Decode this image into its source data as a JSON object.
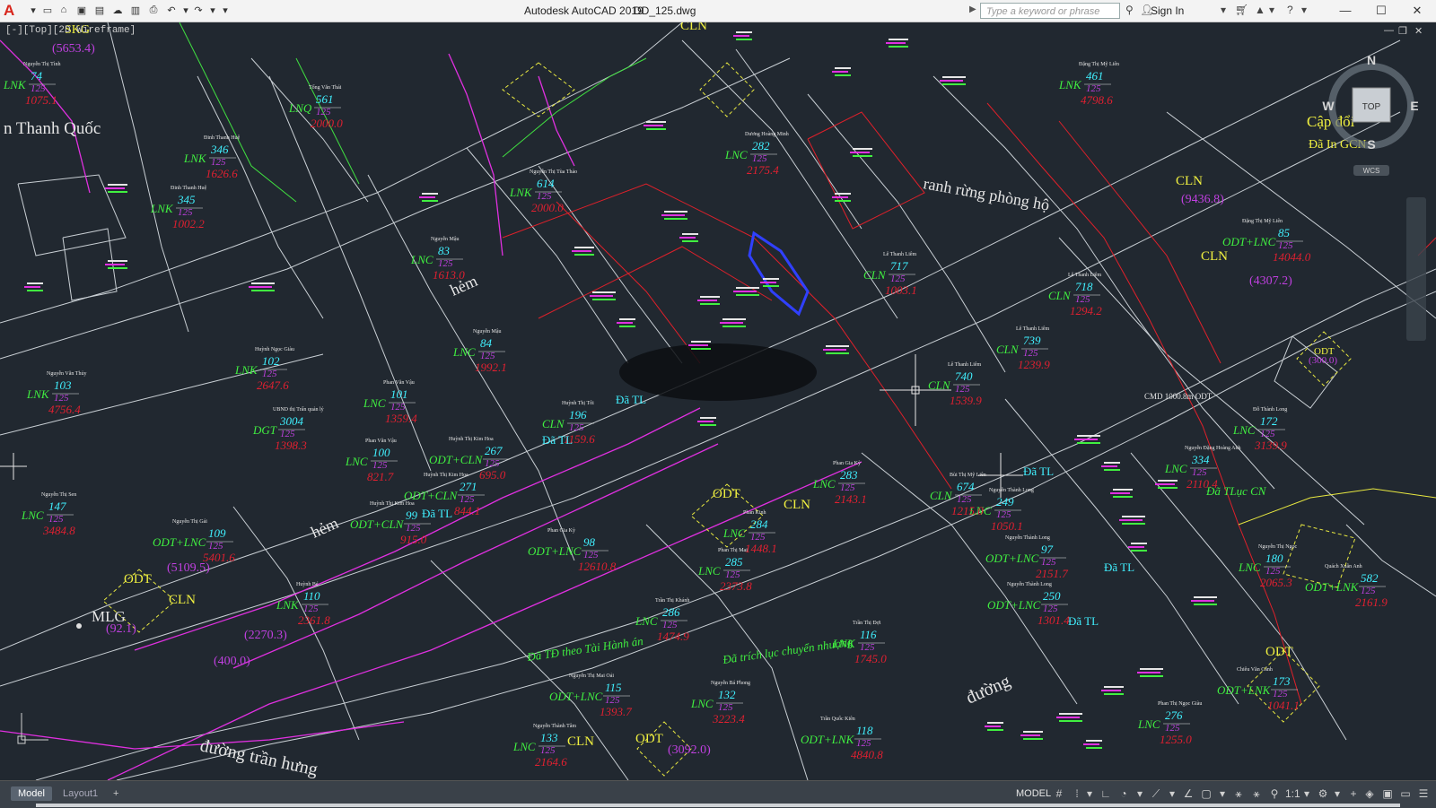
{
  "titlebar": {
    "app_title": "Autodesk AutoCAD 2019",
    "doc_title": "DD_125.dwg",
    "search_placeholder": "Type a keyword or phrase",
    "signin": "Sign In"
  },
  "viewport": {
    "label": "[-][Top][2D Wireframe]",
    "viewcube": {
      "top": "TOP",
      "n": "N",
      "s": "S",
      "e": "E",
      "w": "W",
      "wcs": "WCS"
    }
  },
  "drawing": {
    "big_labels": {
      "road_tran_hung": "đường trần hưng",
      "road_duong": "đường",
      "hem_1": "hẻm",
      "hem_2": "hẻm",
      "ranh_rung": "ranh rừng phòng hộ",
      "name_thanh_quoc": "n Thanh Quốc",
      "cap_doi": "Cập đổi",
      "da_in_gcn": "Đã In GCN",
      "mlg": "MLG",
      "sskg": "SKG"
    },
    "areas": [
      {
        "id": "a1",
        "text": "(5653.4)"
      },
      {
        "id": "a2",
        "text": "(9436.8)"
      },
      {
        "id": "a3",
        "text": "(4307.2)"
      },
      {
        "id": "a4",
        "text": "(5109.5)"
      },
      {
        "id": "a5",
        "text": "(2270.3)"
      },
      {
        "id": "a6",
        "text": "(3092.0)"
      },
      {
        "id": "a7",
        "text": "(92.1)"
      },
      {
        "id": "a8",
        "text": "(300.0)"
      },
      {
        "id": "a9",
        "text": "(400.0)"
      }
    ],
    "zones": [
      {
        "id": "z1",
        "text": "ODT"
      },
      {
        "id": "z2",
        "text": "ODT"
      },
      {
        "id": "z3",
        "text": "ODT"
      },
      {
        "id": "z4",
        "text": "ODT"
      },
      {
        "id": "z5",
        "text": "ODT"
      },
      {
        "id": "z6",
        "text": "CLN"
      },
      {
        "id": "z7",
        "text": "CLN"
      },
      {
        "id": "z8",
        "text": "CLN"
      },
      {
        "id": "z9",
        "text": "CLN"
      },
      {
        "id": "z10",
        "text": "CLN"
      },
      {
        "id": "z11",
        "text": "CLN"
      }
    ],
    "green_notes": [
      {
        "id": "g1",
        "text": "Đã TĐ theo Tài Hành án"
      },
      {
        "id": "g2",
        "text": "Đã trích lục chuyển nhượng"
      },
      {
        "id": "g3",
        "text": "Đã TLục CN"
      }
    ],
    "cyan_notes": [
      {
        "id": "c1",
        "text": "Đã TL"
      },
      {
        "id": "c2",
        "text": "Đã TL"
      },
      {
        "id": "c3",
        "text": "Đã TL"
      },
      {
        "id": "c4",
        "text": "Đã TL"
      },
      {
        "id": "c5",
        "text": "Đã TL"
      },
      {
        "id": "c6",
        "text": "Đã TL"
      }
    ],
    "cmd_label": "CMD\n1000.8m  ODT",
    "parcels": [
      {
        "id": "p1",
        "type": "LNK",
        "num": "74",
        "map": "125",
        "area": "1075.1",
        "owner": "Nguyễn Thị Tình"
      },
      {
        "id": "p2",
        "type": "LNQ",
        "num": "561",
        "map": "125",
        "area": "2000.0",
        "owner": "Tống Văn Thái"
      },
      {
        "id": "p3",
        "type": "LNK",
        "num": "346",
        "map": "125",
        "area": "1626.6",
        "owner": "Đinh Thanh Huệ"
      },
      {
        "id": "p4",
        "type": "LNK",
        "num": "345",
        "map": "125",
        "area": "1002.2",
        "owner": "Đinh Thanh Huệ"
      },
      {
        "id": "p5",
        "type": "LNK",
        "num": "614",
        "map": "125",
        "area": "2000.0",
        "owner": "Nguyễn Thị Tùa Thảo"
      },
      {
        "id": "p6",
        "type": "LNC",
        "num": "282",
        "map": "125",
        "area": "2175.4",
        "owner": "Dương Hoàng Minh"
      },
      {
        "id": "p7",
        "type": "LNK",
        "num": "461",
        "map": "125",
        "area": "4798.6",
        "owner": "Đặng Thị Mỹ Liên"
      },
      {
        "id": "p8",
        "type": "LNK",
        "num": "103",
        "map": "125",
        "area": "4756.4",
        "owner": "Nguyễn Văn Thủy"
      },
      {
        "id": "p9",
        "type": "LNK",
        "num": "102",
        "map": "125",
        "area": "2647.6",
        "owner": "Huỳnh Ngọc Giàu"
      },
      {
        "id": "p10",
        "type": "LNC",
        "num": "83",
        "map": "125",
        "area": "1613.0",
        "owner": "Nguyễn Mậu"
      },
      {
        "id": "p11",
        "type": "LNC",
        "num": "84",
        "map": "125",
        "area": "1992.1",
        "owner": "Nguyễn Mậu"
      },
      {
        "id": "p12",
        "type": "LNC",
        "num": "101",
        "map": "125",
        "area": "1359.4",
        "owner": "Phan Văn Vậu"
      },
      {
        "id": "p13",
        "type": "DGT",
        "num": "3004",
        "map": "125",
        "area": "1398.3",
        "owner": "UBND thị Trấn quản lý"
      },
      {
        "id": "p14",
        "type": "LNC",
        "num": "100",
        "map": "125",
        "area": "821.7",
        "owner": "Phan Văn Vậu"
      },
      {
        "id": "p15",
        "type": "LNC",
        "num": "147",
        "map": "125",
        "area": "3484.8",
        "owner": "Nguyễn Thị Sen"
      },
      {
        "id": "p16",
        "type": "ODT+LNC",
        "num": "109",
        "map": "125",
        "area": "5401.6",
        "owner": "Nguyễn Thị Gái"
      },
      {
        "id": "p17",
        "type": "LNK",
        "num": "110",
        "map": "125",
        "area": "2361.8",
        "owner": "Huỳnh Bé"
      },
      {
        "id": "p18",
        "type": "CLN",
        "num": "196",
        "map": "125",
        "area": "1159.6",
        "owner": "Huỳnh Thị Tôi"
      },
      {
        "id": "p19",
        "type": "ODT+CLN",
        "num": "267",
        "map": "125",
        "area": "695.0",
        "owner": "Huỳnh Thị Kim Hoa"
      },
      {
        "id": "p20",
        "type": "ODT+CLN",
        "num": "271",
        "map": "125",
        "area": "844.1",
        "owner": "Huỳnh Thị Kim Hoa"
      },
      {
        "id": "p21",
        "type": "ODT+CLN",
        "num": "99",
        "map": "125",
        "area": "915.0",
        "owner": "Huỳnh Thị Kim Hoa"
      },
      {
        "id": "p22",
        "type": "ODT+LNC",
        "num": "98",
        "map": "125",
        "area": "12610.8",
        "owner": "Phan Gia Kỳ"
      },
      {
        "id": "p23",
        "type": "LNC",
        "num": "283",
        "map": "125",
        "area": "2143.1",
        "owner": "Phan Gia Kỳ"
      },
      {
        "id": "p24",
        "type": "LNC",
        "num": "284",
        "map": "125",
        "area": "1448.1",
        "owner": "Phan Kinh"
      },
      {
        "id": "p25",
        "type": "LNC",
        "num": "285",
        "map": "125",
        "area": "2373.8",
        "owner": "Phan Thị Mai"
      },
      {
        "id": "p26",
        "type": "LNC",
        "num": "286",
        "map": "125",
        "area": "1474.9",
        "owner": "Trần Thị Khánh"
      },
      {
        "id": "p27",
        "type": "LNK",
        "num": "116",
        "map": "125",
        "area": "1745.0",
        "owner": "Trần Thị Đợi"
      },
      {
        "id": "p28",
        "type": "LNC",
        "num": "132",
        "map": "125",
        "area": "3223.4",
        "owner": "Nguyễn Bá Phong"
      },
      {
        "id": "p29",
        "type": "ODT+LNK",
        "num": "118",
        "map": "125",
        "area": "4840.8",
        "owner": "Trần Quốc Kiên"
      },
      {
        "id": "p30",
        "type": "ODT+LNC",
        "num": "115",
        "map": "125",
        "area": "1393.7",
        "owner": "Nguyễn Thị Mai Oải"
      },
      {
        "id": "p31",
        "type": "LNC",
        "num": "133",
        "map": "125",
        "area": "2164.6",
        "owner": "Nguyễn Thành Tâm"
      },
      {
        "id": "p32",
        "type": "LNC",
        "num": "249",
        "map": "125",
        "area": "1050.1",
        "owner": "Nguyễn Thành Long"
      },
      {
        "id": "p33",
        "type": "LNC",
        "num": "334",
        "map": "125",
        "area": "2110.4",
        "owner": "Nguyễn Đặng Hoàng Anh"
      },
      {
        "id": "p34",
        "type": "LNC",
        "num": "172",
        "map": "125",
        "area": "3139.9",
        "owner": "Đỗ Thành Long"
      },
      {
        "id": "p35",
        "type": "ODT+LNC",
        "num": "97",
        "map": "125",
        "area": "2151.7",
        "owner": "Nguyễn Thành Long"
      },
      {
        "id": "p36",
        "type": "ODT+LNC",
        "num": "250",
        "map": "125",
        "area": "1301.4",
        "owner": "Nguyễn Thành Long"
      },
      {
        "id": "p37",
        "type": "LNC",
        "num": "180",
        "map": "125",
        "area": "2065.3",
        "owner": "Nguyễn Thị Ngọc"
      },
      {
        "id": "p38",
        "type": "ODT+LNK",
        "num": "582",
        "map": "125",
        "area": "2161.9",
        "owner": "Quách Xuân Anh"
      },
      {
        "id": "p39",
        "type": "LNC",
        "num": "276",
        "map": "125",
        "area": "1255.0",
        "owner": "Phan Thị Ngọc Giàu"
      },
      {
        "id": "p40",
        "type": "ODT+LNK",
        "num": "173",
        "map": "125",
        "area": "1041.1",
        "owner": "Chiêu Văn Cảnh"
      },
      {
        "id": "p41",
        "type": "ODT+LNC",
        "num": "85",
        "map": "125",
        "area": "14044.0",
        "owner": "Đặng Thị Mỹ Liên"
      },
      {
        "id": "p42",
        "type": "CLN",
        "num": "717",
        "map": "125",
        "area": "1003.1",
        "owner": "Lê Thanh Liêm"
      },
      {
        "id": "p43",
        "type": "CLN",
        "num": "718",
        "map": "125",
        "area": "1294.2",
        "owner": "Lê Thanh Liêm"
      },
      {
        "id": "p44",
        "type": "CLN",
        "num": "739",
        "map": "125",
        "area": "1239.9",
        "owner": "Lê Thanh Liêm"
      },
      {
        "id": "p45",
        "type": "CLN",
        "num": "740",
        "map": "125",
        "area": "1539.9",
        "owner": "Lê Thanh Liêm"
      },
      {
        "id": "p46",
        "type": "CLN",
        "num": "674",
        "map": "125",
        "area": "1215.0",
        "owner": "Bùi Thị Mỹ Liên"
      }
    ]
  },
  "statusbar": {
    "tab_model": "Model",
    "tab_layout1": "Layout1",
    "tab_add": "+",
    "model_label": "MODEL",
    "scale": "1:1"
  },
  "colors": {
    "background": "#212830",
    "parcel_line": "#d8d8d8",
    "red_line": "#e0202a",
    "magenta": "#e020e0",
    "cyan": "#40f0ff",
    "green": "#40f040",
    "yellow": "#f0f040"
  }
}
